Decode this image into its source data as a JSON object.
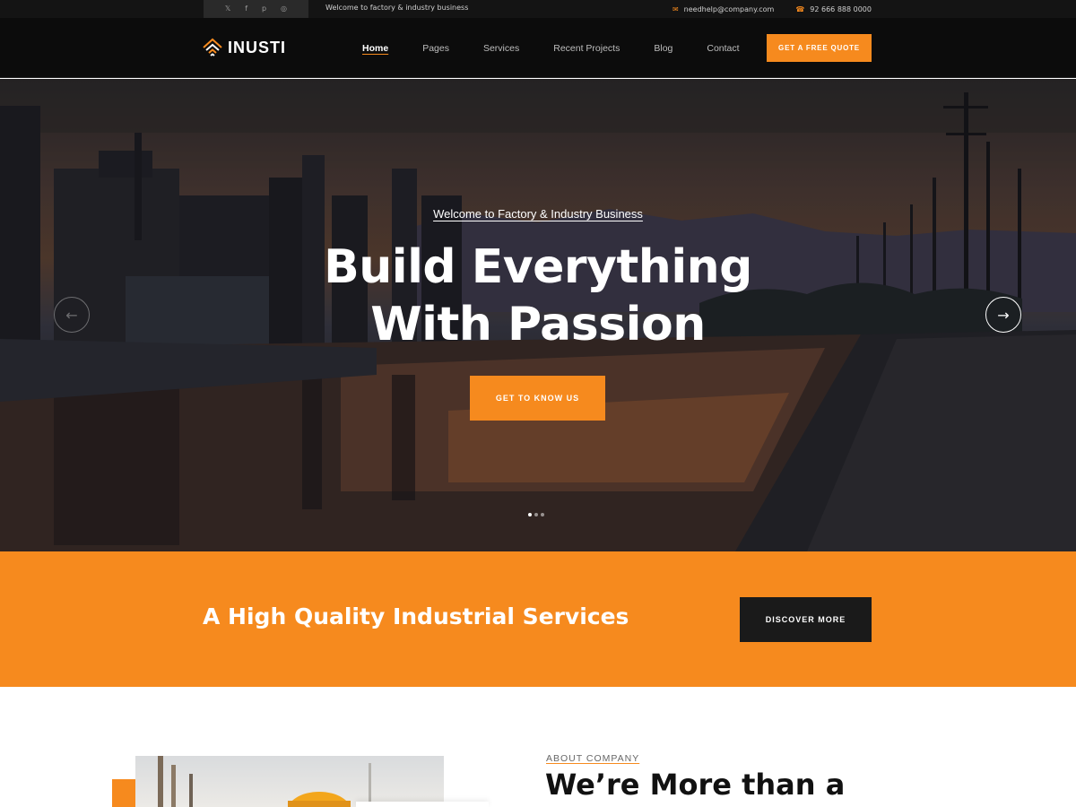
{
  "topbar": {
    "social_icons": [
      "twitter-icon",
      "facebook-icon",
      "pinterest-icon",
      "instagram-icon"
    ],
    "welcome": "Welcome to factory & industry business",
    "email": "needhelp@company.com",
    "phone": "92 666 888 0000"
  },
  "header": {
    "logo": "INUSTI",
    "nav": [
      "Home",
      "Pages",
      "Services",
      "Recent Projects",
      "Blog",
      "Contact"
    ],
    "active_nav": "Home",
    "quote_button": "GET A FREE QUOTE"
  },
  "hero": {
    "subtitle": "Welcome to Factory & Industry Business",
    "title_line1": "Build Everything",
    "title_line2": "With Passion",
    "button": "GET TO KNOW US",
    "slides": 3,
    "active_slide": 1
  },
  "band": {
    "title": "A High Quality Industrial Services",
    "button": "DISCOVER MORE"
  },
  "about": {
    "label": "ABOUT COMPANY",
    "title": "We’re More than a"
  },
  "colors": {
    "accent": "#f68a1e",
    "dark": "#0c0c0c"
  }
}
